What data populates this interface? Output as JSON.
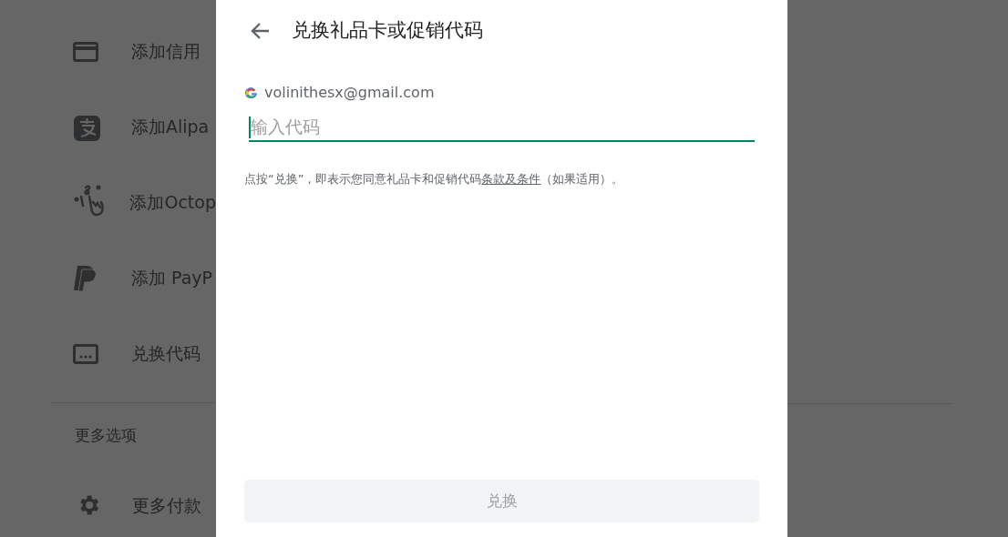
{
  "background_menu": {
    "items": [
      {
        "label": "添加信用"
      },
      {
        "label": "添加Alipa"
      },
      {
        "label": "添加Octop"
      },
      {
        "label": "添加 PayP"
      },
      {
        "label": "兑换代码"
      }
    ],
    "section_title": "更多选项",
    "settings_item": {
      "label": "更多付款"
    }
  },
  "dialog": {
    "title": "兑换礼品卡或促销代码",
    "account": "volinithesx@gmail.com",
    "code_field": {
      "placeholder": "输入代码",
      "focused": true
    },
    "terms": {
      "before": "点按“兑换”，即表示您同意礼品卡和促销代码",
      "link": "条款及条件",
      "after": "（如果适用）。"
    },
    "redeem_button": {
      "label": "兑换",
      "disabled": true
    }
  }
}
